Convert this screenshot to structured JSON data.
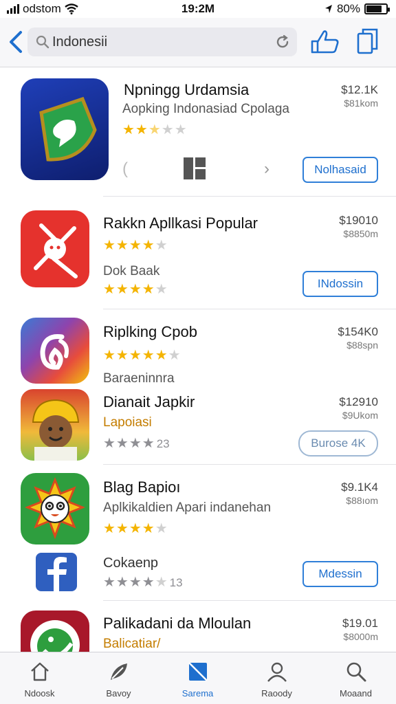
{
  "status_bar": {
    "carrier": "odstom",
    "time": "19:2M",
    "battery": "80%",
    "battery_level": 0.8
  },
  "search": {
    "query": "Indonesii"
  },
  "apps": [
    {
      "name": "Npningg Urdamsia",
      "subtitle": "Aopking Indonasiad Cpolaga",
      "rating": 3,
      "price": "$12.1K",
      "price_sub": "$81kom",
      "button": "Nolhasaid",
      "icon": "green-speech-bubble-app-icon"
    },
    {
      "name": "Rakkn Apllkasi Popular",
      "rating": 4,
      "subtitle": "Dok Baak",
      "rating2": 4,
      "price": "$19010",
      "price_sub": "$8850m",
      "button": "INdossin",
      "icon": "red-figure-app-icon"
    },
    {
      "name": "Riplking Cpob",
      "rating": 5,
      "subtitle": "Baraeninnra",
      "price": "$154K0",
      "price_sub": "$88spn",
      "icon": "gradient-swirl-app-icon"
    },
    {
      "name": "Dianait Japkir",
      "subtitle": "Lapoiasi",
      "rating": 4,
      "rating_count": "23",
      "price": "$12910",
      "price_sub": "$9Ukom",
      "button": "Burose 4K",
      "icon": "cartoon-character-app-icon"
    },
    {
      "name": "Blag Bapioı",
      "subtitle": "Aplkikaldien Apari indanehan",
      "rating": 4,
      "price": "$9.1K4",
      "price_sub": "$88ıom",
      "icon": "sun-face-app-icon"
    },
    {
      "name": "Cokaenp",
      "rating": 4,
      "rating_count": "13",
      "button": "Mdessin",
      "icon": "facebook-app-icon"
    },
    {
      "name": "Palikadani da Mloulan",
      "subtitle": "Balicatiar/",
      "price": "$19.01",
      "price_sub": "$8000m",
      "icon": "green-bird-app-icon"
    }
  ],
  "tabs": [
    {
      "label": "Ndoosk",
      "icon": "home-icon"
    },
    {
      "label": "Bavoy",
      "icon": "feather-icon"
    },
    {
      "label": "Sarema",
      "icon": "apps-icon",
      "active": true
    },
    {
      "label": "Raoody",
      "icon": "person-icon"
    },
    {
      "label": "Moaand",
      "icon": "search-icon"
    }
  ],
  "colors": {
    "accent": "#1e6fce",
    "star": "#f4b400"
  }
}
